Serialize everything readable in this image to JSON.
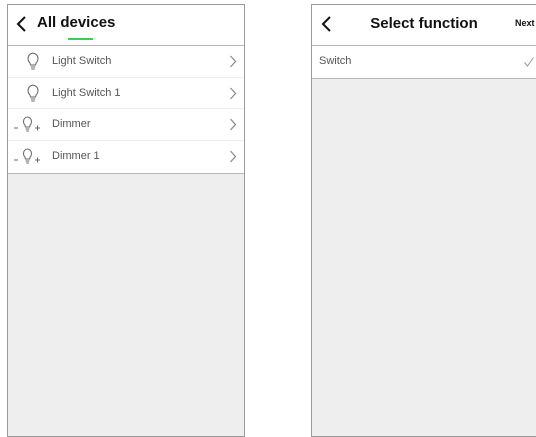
{
  "left_screen": {
    "title": "All devices",
    "devices": [
      {
        "label": "Light Switch",
        "icon": "lightbulb-icon"
      },
      {
        "label": "Light Switch 1",
        "icon": "lightbulb-icon"
      },
      {
        "label": "Dimmer",
        "icon": "dimmer-icon"
      },
      {
        "label": "Dimmer 1",
        "icon": "dimmer-icon"
      }
    ]
  },
  "right_screen": {
    "title": "Select function",
    "next_label": "Next",
    "functions": [
      {
        "label": "Switch",
        "selected": true
      }
    ]
  },
  "colors": {
    "accent": "#3dcd58",
    "background": "#eeeeee",
    "list_background": "#ffffff"
  }
}
